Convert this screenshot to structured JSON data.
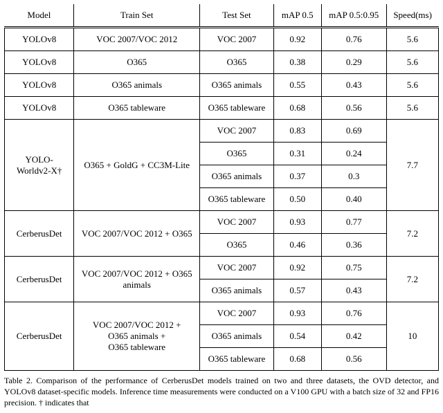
{
  "chart_data": {
    "type": "table",
    "columns": [
      "Model",
      "Train Set",
      "Test Set",
      "mAP 0.5",
      "mAP 0.5:0.95",
      "Speed(ms)"
    ],
    "rows": [
      {
        "model": "YOLOv8",
        "train": "VOC 2007/VOC 2012",
        "test": "VOC 2007",
        "map50": "0.92",
        "map5095": "0.76",
        "speed": "5.6"
      },
      {
        "model": "YOLOv8",
        "train": "O365",
        "test": "O365",
        "map50": "0.38",
        "map5095": "0.29",
        "speed": "5.6"
      },
      {
        "model": "YOLOv8",
        "train": "O365 animals",
        "test": "O365 animals",
        "map50": "0.55",
        "map5095": "0.43",
        "speed": "5.6"
      },
      {
        "model": "YOLOv8",
        "train": "O365 tableware",
        "test": "O365 tableware",
        "map50": "0.68",
        "map5095": "0.56",
        "speed": "5.6"
      },
      {
        "model": "YOLO-Worldv2-X†",
        "train": "O365 + GoldG + CC3M-Lite",
        "test": "VOC 2007",
        "map50": "0.83",
        "map5095": "0.69",
        "speed": "7.7"
      },
      {
        "model": "",
        "train": "",
        "test": "O365",
        "map50": "0.31",
        "map5095": "0.24",
        "speed": ""
      },
      {
        "model": "",
        "train": "",
        "test": "O365 animals",
        "map50": "0.37",
        "map5095": "0.3",
        "speed": ""
      },
      {
        "model": "",
        "train": "",
        "test": "O365 tableware",
        "map50": "0.50",
        "map5095": "0.40",
        "speed": ""
      },
      {
        "model": "CerberusDet",
        "train": "VOC 2007/VOC 2012 + O365",
        "test": "VOC 2007",
        "map50": "0.93",
        "map5095": "0.77",
        "speed": "7.2"
      },
      {
        "model": "",
        "train": "",
        "test": "O365",
        "map50": "0.46",
        "map5095": "0.36",
        "speed": ""
      },
      {
        "model": "CerberusDet",
        "train": "VOC 2007/VOC 2012 + O365 animals",
        "test": "VOC 2007",
        "map50": "0.92",
        "map5095": "0.75",
        "speed": "7.2"
      },
      {
        "model": "",
        "train": "",
        "test": "O365 animals",
        "map50": "0.57",
        "map5095": "0.43",
        "speed": ""
      },
      {
        "model": "CerberusDet",
        "train": "VOC 2007/VOC 2012 + O365 animals + O365 tableware",
        "test": "VOC 2007",
        "map50": "0.93",
        "map5095": "0.76",
        "speed": "10"
      },
      {
        "model": "",
        "train": "",
        "test": "O365 animals",
        "map50": "0.54",
        "map5095": "0.42",
        "speed": ""
      },
      {
        "model": "",
        "train": "",
        "test": "O365 tableware",
        "map50": "0.68",
        "map5095": "0.56",
        "speed": ""
      }
    ]
  },
  "header": {
    "col0": "Model",
    "col1": "Train Set",
    "col2": "Test Set",
    "col3": "mAP 0.5",
    "col4": "mAP 0.5:0.95",
    "col5": "Speed(ms)"
  },
  "cells": {
    "r0": {
      "model": "YOLOv8",
      "train": "VOC 2007/VOC 2012",
      "test": "VOC 2007",
      "m50": "0.92",
      "m95": "0.76",
      "spd": "5.6"
    },
    "r1": {
      "model": "YOLOv8",
      "train": "O365",
      "test": "O365",
      "m50": "0.38",
      "m95": "0.29",
      "spd": "5.6"
    },
    "r2": {
      "model": "YOLOv8",
      "train": "O365 animals",
      "test": "O365 animals",
      "m50": "0.55",
      "m95": "0.43",
      "spd": "5.6"
    },
    "r3": {
      "model": "YOLOv8",
      "train": "O365 tableware",
      "test": "O365 tableware",
      "m50": "0.68",
      "m95": "0.56",
      "spd": "5.6"
    },
    "g1": {
      "model": "YOLO-Worldv2-X†",
      "train": "O365 + GoldG + CC3M-Lite",
      "spd": "7.7",
      "t0": "VOC 2007",
      "a0": "0.83",
      "b0": "0.69",
      "t1": "O365",
      "a1": "0.31",
      "b1": "0.24",
      "t2": "O365 animals",
      "a2": "0.37",
      "b2": "0.3",
      "t3": "O365 tableware",
      "a3": "0.50",
      "b3": "0.40"
    },
    "g2": {
      "model": "CerberusDet",
      "train": "VOC 2007/VOC 2012 + O365",
      "spd": "7.2",
      "t0": "VOC 2007",
      "a0": "0.93",
      "b0": "0.77",
      "t1": "O365",
      "a1": "0.46",
      "b1": "0.36"
    },
    "g3": {
      "model": "CerberusDet",
      "train": "VOC 2007/VOC 2012 + O365 animals",
      "spd": "7.2",
      "t0": "VOC 2007",
      "a0": "0.92",
      "b0": "0.75",
      "t1": "O365 animals",
      "a1": "0.57",
      "b1": "0.43"
    },
    "g4": {
      "model": "CerberusDet",
      "train_l1": "VOC 2007/VOC 2012 +",
      "train_l2": "O365 animals +",
      "train_l3": "O365 tableware",
      "spd": "10",
      "t0": "VOC 2007",
      "a0": "0.93",
      "b0": "0.76",
      "t1": "O365 animals",
      "a1": "0.54",
      "b1": "0.42",
      "t2": "O365 tableware",
      "a2": "0.68",
      "b2": "0.56"
    }
  },
  "caption": "Table 2. Comparison of the performance of CerberusDet models trained on two and three datasets, the OVD detector, and YOLOv8 dataset-specific models. Inference time measurements were conducted on a V100 GPU with a batch size of 32 and FP16 precision. † indicates that"
}
